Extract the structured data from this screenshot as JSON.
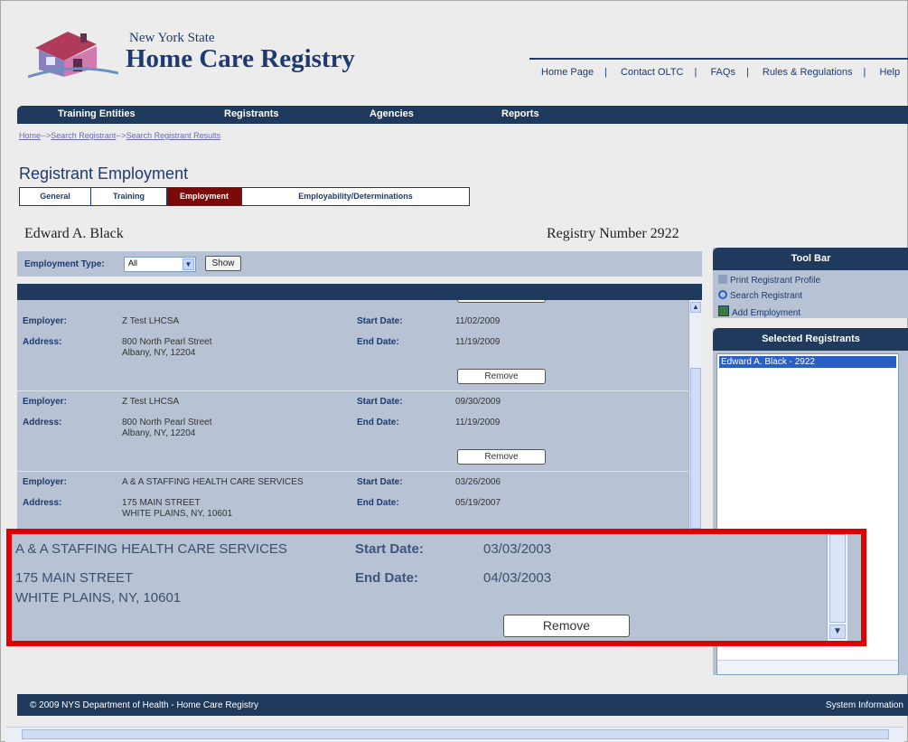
{
  "brand": {
    "state": "New York State",
    "name": "Home Care Registry"
  },
  "top_links": [
    "Home Page",
    "Contact OLTC",
    "FAQs",
    "Rules & Regulations",
    "Help"
  ],
  "nav": [
    "Training Entities",
    "Registrants",
    "Agencies",
    "Reports"
  ],
  "breadcrumb": {
    "home": "Home",
    "search": "Search Registrant",
    "results": "Search Registrant Results",
    "arrow": "-->"
  },
  "page_title": "Registrant Employment",
  "tabs": [
    "General",
    "Training",
    "Employment",
    "Employability/Determinations"
  ],
  "person": {
    "name": "Edward A. Black",
    "registry_number": "Registry Number 2922"
  },
  "filter": {
    "label": "Employment Type:",
    "selected": "All",
    "show_label": "Show"
  },
  "labels": {
    "employer": "Employer:",
    "address": "Address:",
    "start": "Start Date:",
    "end": "End Date:",
    "remove": "Remove"
  },
  "records": [
    {
      "employer": "Z Test LHCSA",
      "address1": "800 North Pearl Street",
      "address2": "Albany, NY, 12204",
      "start": "11/02/2009",
      "end": "11/19/2009"
    },
    {
      "employer": "Z Test LHCSA",
      "address1": "800 North Pearl Street",
      "address2": "Albany, NY, 12204",
      "start": "09/30/2009",
      "end": "11/19/2009"
    },
    {
      "employer": "A & A STAFFING HEALTH CARE SERVICES",
      "address1": "175 MAIN STREET",
      "address2": "WHITE PLAINS, NY, 10601",
      "start": "03/26/2006",
      "end": "05/19/2007"
    }
  ],
  "zoom_record": {
    "employer": "A & A STAFFING HEALTH CARE SERVICES",
    "address1": "175 MAIN STREET",
    "address2": "WHITE PLAINS, NY, 10601",
    "start": "03/03/2003",
    "end": "04/03/2003"
  },
  "toolbar": {
    "title": "Tool Bar",
    "items": [
      "Print Registrant Profile",
      "Search Registrant",
      "Add Employment"
    ]
  },
  "selected": {
    "title": "Selected Registrants",
    "items": [
      "Edward A. Black - 2922"
    ]
  },
  "footer": {
    "copyright": "© 2009 NYS Department of Health - Home Care Registry",
    "system_info": "System Information"
  },
  "colors": {
    "navy": "#1f3a5c",
    "panel": "#b7c2d4",
    "active_tab": "#7a0a0a",
    "highlight": "#e00000"
  }
}
